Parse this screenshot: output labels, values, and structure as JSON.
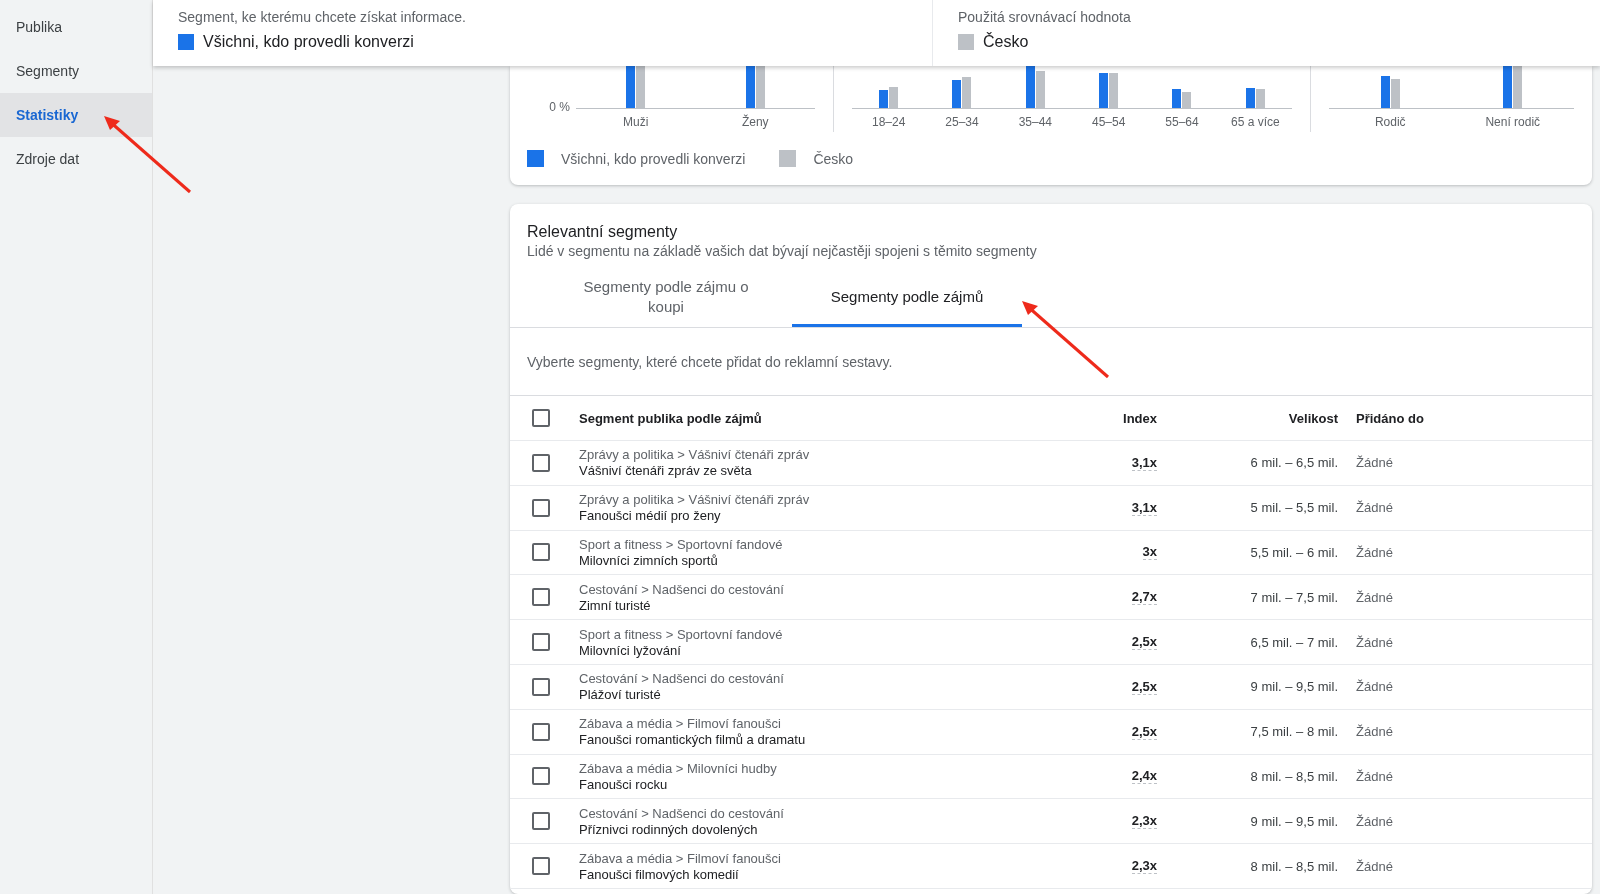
{
  "sidebar": {
    "items": [
      {
        "label": "Publika",
        "selected": false
      },
      {
        "label": "Segmenty",
        "selected": false
      },
      {
        "label": "Statistiky",
        "selected": true
      },
      {
        "label": "Zdroje dat",
        "selected": false
      }
    ]
  },
  "header": {
    "segments": [
      {
        "caption": "Segment, ke kterému chcete získat informace.",
        "value": "Všichni, kdo provedli konverzi",
        "color": "#1a73e8"
      },
      {
        "caption": "Použitá srovnávací hodnota",
        "value": "Česko",
        "color": "#bdc1c6"
      }
    ]
  },
  "charts": {
    "panels": [
      {
        "axis_label": "0 %",
        "categories": [
          "Muži",
          "Ženy"
        ]
      },
      {
        "categories": [
          "18–24",
          "25–34",
          "35–44",
          "45–54",
          "55–64",
          "65 a více"
        ]
      },
      {
        "categories": [
          "Rodič",
          "Není rodič"
        ]
      }
    ],
    "legend": [
      {
        "label": "Všichni, kdo provedli konverzi",
        "color": "#1a73e8"
      },
      {
        "label": "Česko",
        "color": "#bdc1c6"
      }
    ]
  },
  "relevant": {
    "title": "Relevantní segmenty",
    "subtitle": "Lidé v segmentu na základě vašich dat bývají nejčastěji spojeni s těmito segmenty",
    "tabs": [
      {
        "label": "Segmenty podle zájmu o koupi",
        "selected": false
      },
      {
        "label": "Segmenty podle zájmů",
        "selected": true
      }
    ],
    "instruction": "Vyberte segmenty, které chcete přidat do reklamní sestavy.",
    "header_checked": false,
    "columns": [
      "Segment publika podle zájmů",
      "Index",
      "Velikost",
      "Přidáno do"
    ],
    "rows": [
      {
        "path": "Zprávy a politika > Vášniví čtenáři zpráv",
        "name": "Vášniví čtenáři zpráv ze světa",
        "index": "3,1x",
        "size": "6 mil. – 6,5 mil.",
        "added": "Žádné",
        "checked": false
      },
      {
        "path": "Zprávy a politika > Vášniví čtenáři zpráv",
        "name": "Fanoušci médií pro ženy",
        "index": "3,1x",
        "size": "5 mil. – 5,5 mil.",
        "added": "Žádné",
        "checked": false
      },
      {
        "path": "Sport a fitness > Sportovní fandové",
        "name": "Milovníci zimních sportů",
        "index": "3x",
        "size": "5,5 mil. – 6 mil.",
        "added": "Žádné",
        "checked": false
      },
      {
        "path": "Cestování > Nadšenci do cestování",
        "name": "Zimní turisté",
        "index": "2,7x",
        "size": "7 mil. – 7,5 mil.",
        "added": "Žádné",
        "checked": false
      },
      {
        "path": "Sport a fitness > Sportovní fandové",
        "name": "Milovníci lyžování",
        "index": "2,5x",
        "size": "6,5 mil. – 7 mil.",
        "added": "Žádné",
        "checked": false
      },
      {
        "path": "Cestování > Nadšenci do cestování",
        "name": "Plážoví turisté",
        "index": "2,5x",
        "size": "9 mil. – 9,5 mil.",
        "added": "Žádné",
        "checked": false
      },
      {
        "path": "Zábava a média > Filmoví fanoušci",
        "name": "Fanoušci romantických filmů a dramatu",
        "index": "2,5x",
        "size": "7,5 mil. – 8 mil.",
        "added": "Žádné",
        "checked": false
      },
      {
        "path": "Zábava a média > Milovníci hudby",
        "name": "Fanoušci rocku",
        "index": "2,4x",
        "size": "8 mil. – 8,5 mil.",
        "added": "Žádné",
        "checked": false
      },
      {
        "path": "Cestování > Nadšenci do cestování",
        "name": "Příznivci rodinných dovolených",
        "index": "2,3x",
        "size": "9 mil. – 9,5 mil.",
        "added": "Žádné",
        "checked": false
      },
      {
        "path": "Zábava a média > Filmoví fanoušci",
        "name": "Fanoušci filmových komedií",
        "index": "2,3x",
        "size": "8 mil. – 8,5 mil.",
        "added": "Žádné",
        "checked": false
      }
    ]
  }
}
